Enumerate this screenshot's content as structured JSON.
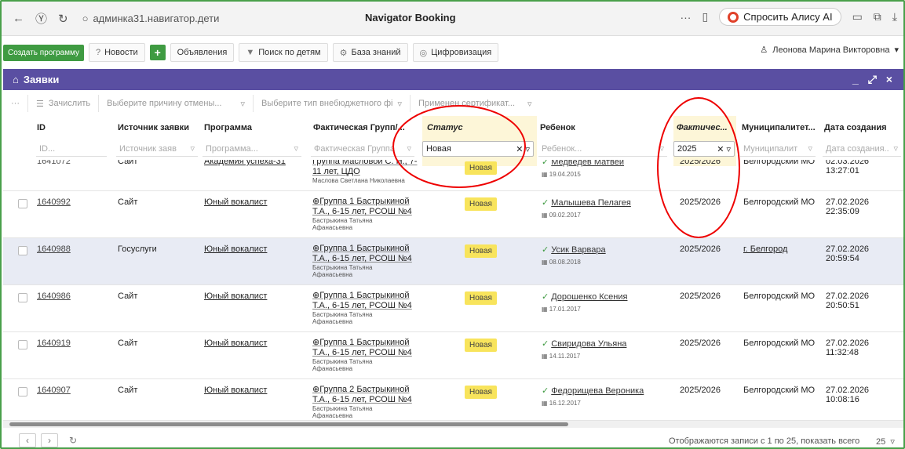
{
  "browser": {
    "url": "админка31.навигатор.дети",
    "title": "Navigator Booking",
    "alice_label": "Спросить Алису AI",
    "more_icon": "···"
  },
  "toolbar": {
    "create_program": "Создать программу",
    "news": "Новости",
    "announcements": "Объявления",
    "child_search": "Поиск по детям",
    "knowledge_base": "База знаний",
    "digitalization": "Цифровизация",
    "user_name": "Леонова Марина Викторовна"
  },
  "panel": {
    "title": "Заявки"
  },
  "filterbar": {
    "enroll": "Зачислить",
    "cancel_reason_placeholder": "Выберите причину отмены...",
    "offbudget_placeholder": "Выберите тип внебюджетного фі",
    "certificate_placeholder": "Применен сертификат..."
  },
  "columns": {
    "id": "ID",
    "source": "Источник заявки",
    "program": "Программа",
    "group": "Фактическая Групп/...",
    "status": "Статус",
    "child": "Ребенок",
    "year": "Фактичес...",
    "municipality": "Муниципалитет...",
    "created": "Дата создания"
  },
  "filters": {
    "id": "ID...",
    "source": "Источник заяв",
    "program": "Программа...",
    "group": "Фактическая Группа",
    "status": "Новая",
    "child": "Ребенок...",
    "year": "2025",
    "municipality": "Муниципалит",
    "created": "Дата создания.."
  },
  "partial_row": {
    "id": "1641072",
    "source": "Сайт",
    "program": "Академия успеха-31",
    "group": "Группа Масловой С. Н., 7-11 лет, ЦДО",
    "teacher": "Маслова Светлана Николаевна",
    "status": "Новая",
    "child": "Медведев Матвей",
    "birth": "19.04.2015",
    "year": "2025/2026",
    "municipality": "Белгородский МО",
    "created": "02.03.2026 13:27:01"
  },
  "rows": [
    {
      "id": "1640992",
      "source": "Сайт",
      "program": "Юный вокалист",
      "group1": "Группа 1 Бастрыкиной",
      "group2": "Т.А., 6-15 лет, РСОШ №4",
      "teacher1": "Бастрыкина Татьяна",
      "teacher2": "Афанасьевна",
      "status": "Новая",
      "child": "Малышева Пелагея",
      "birth": "09.02.2017",
      "year": "2025/2026",
      "municipality": "Белгородский МО",
      "created": "27.02.2026 22:35:09"
    },
    {
      "id": "1640988",
      "source": "Госуслуги",
      "program": "Юный вокалист",
      "group1": "Группа 1 Бастрыкиной",
      "group2": "Т.А., 6-15 лет, РСОШ №4",
      "teacher1": "Бастрыкина Татьяна",
      "teacher2": "Афанасьевна",
      "status": "Новая",
      "child": "Усик Варвара",
      "birth": "08.08.2018",
      "year": "2025/2026",
      "municipality": "г. Белгород",
      "created": "27.02.2026 20:59:54"
    },
    {
      "id": "1640986",
      "source": "Сайт",
      "program": "Юный вокалист",
      "group1": "Группа 1 Бастрыкиной",
      "group2": "Т.А., 6-15 лет, РСОШ №4",
      "teacher1": "Бастрыкина Татьяна",
      "teacher2": "Афанасьевна",
      "status": "Новая",
      "child": "Дорошенко Ксения",
      "birth": "17.01.2017",
      "year": "2025/2026",
      "municipality": "Белгородский МО",
      "created": "27.02.2026 20:50:51"
    },
    {
      "id": "1640919",
      "source": "Сайт",
      "program": "Юный вокалист",
      "group1": "Группа 1 Бастрыкиной",
      "group2": "Т.А., 6-15 лет, РСОШ №4",
      "teacher1": "Бастрыкина Татьяна",
      "teacher2": "Афанасьевна",
      "status": "Новая",
      "child": "Свиридова Ульяна",
      "birth": "14.11.2017",
      "year": "2025/2026",
      "municipality": "Белгородский МО",
      "created": "27.02.2026 11:32:48"
    },
    {
      "id": "1640907",
      "source": "Сайт",
      "program": "Юный вокалист",
      "group1": "Группа 2 Бастрыкиной",
      "group2": "Т.А., 6-15 лет, РСОШ №4",
      "teacher1": "Бастрыкина Татьяна",
      "teacher2": "Афанасьевна",
      "status": "Новая",
      "child": "Федорищева Вероника",
      "birth": "16.12.2017",
      "year": "2025/2026",
      "municipality": "Белгородский МО",
      "created": "27.02.2026 10:08:16"
    }
  ],
  "footer": {
    "summary": "Отображаются записи с 1 по 25, показать всего",
    "page_size": "25"
  },
  "colors": {
    "accent_purple": "#5a4fa2",
    "brand_green": "#3f9b42",
    "status_yellow": "#f8e45c",
    "annotation_red": "#e00000"
  }
}
